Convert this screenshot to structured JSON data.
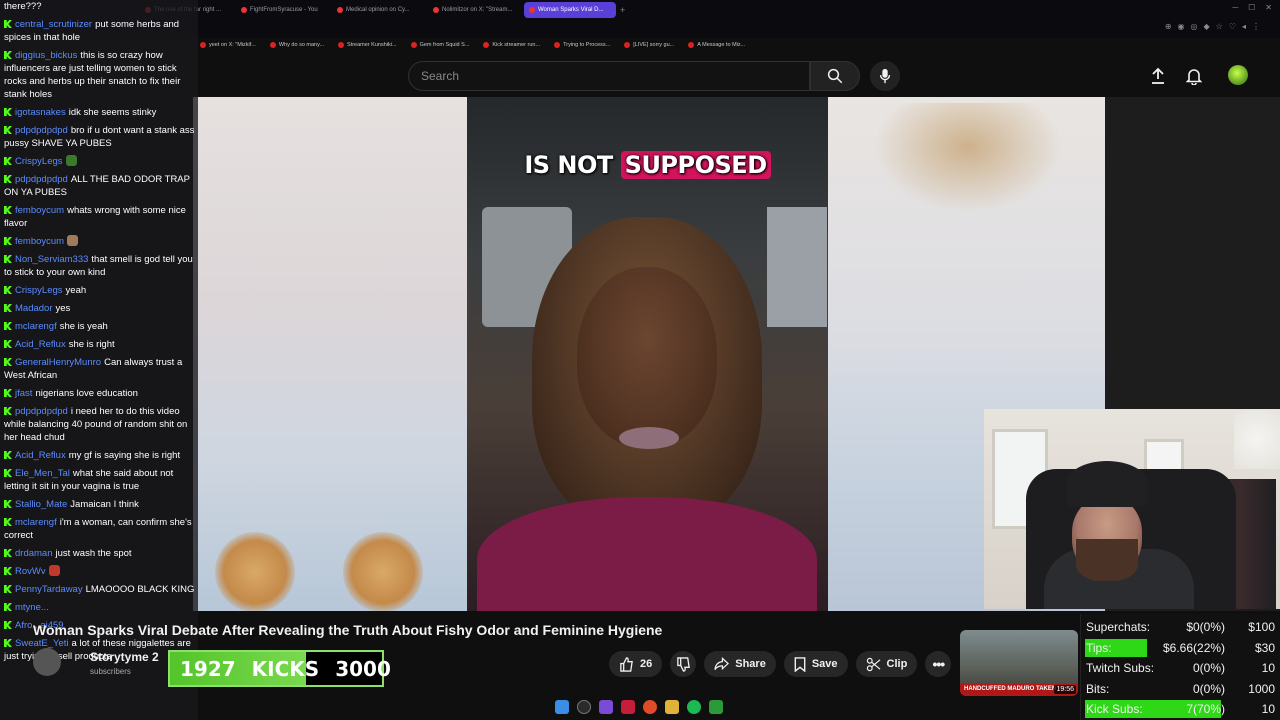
{
  "browser": {
    "tabs": [
      "The rise of the far right ...",
      "FightFromSyracuse - You",
      "Medical opinion on Cy...",
      "Nolimitzor on X: \"Stream...",
      "Woman Sparks Viral D..."
    ],
    "active_tab": 4,
    "bookmarks": [
      "yeet on X: \"Mizkif...",
      "Why do so many...",
      "Streamer Kunshiki...",
      "Gem from Squid S...",
      "Kick streamer run...",
      "Trying to Process...",
      "[LIVE] sorry gu...",
      "A Message to Miz..."
    ]
  },
  "header": {
    "search_placeholder": "Search"
  },
  "video": {
    "caption_plain": "IS NOT",
    "caption_highlight": "SUPPOSED",
    "title": "Woman Sparks Viral Debate After Revealing the Truth About Fishy Odor and Feminine Hygiene",
    "channel": "Storytyme 2",
    "channel_subs": "subscribers",
    "likes": "26",
    "share": "Share",
    "save": "Save",
    "clip": "Clip",
    "thumb_banner": "HANDCUFFED MADURO TAKEN TO",
    "thumb_duration": "19:56"
  },
  "kicks_goal": {
    "current": "1927",
    "label": "KICKS",
    "goal": "3000",
    "progress": 0.642
  },
  "stats": [
    {
      "label": "Superchats:",
      "value": "$0(0%)",
      "goal": "$100",
      "fill": 0.0,
      "highlight_label": false
    },
    {
      "label": "Tips:",
      "value": "$6.66(22%)",
      "goal": "$30",
      "fill": 0.22,
      "highlight_label": true
    },
    {
      "label": "Twitch Subs:",
      "value": "0(0%)",
      "goal": "10",
      "fill": 0.0,
      "highlight_label": false
    },
    {
      "label": "Bits:",
      "value": "0(0%)",
      "goal": "1000",
      "fill": 0.0,
      "highlight_label": false
    },
    {
      "label": "Kick Subs:",
      "value": "7(70%)",
      "goal": "10",
      "fill": 0.7,
      "highlight_label": true
    }
  ],
  "chat": {
    "first_line": "there???",
    "messages": [
      {
        "user": "central_scrutinizer",
        "text": "put some herbs and spices in that hole"
      },
      {
        "user": "diggius_bickus",
        "text": "this is so crazy how influencers are just telling women to stick rocks and herbs up their snatch to fix their stank holes"
      },
      {
        "user": "igotasnakes",
        "text": "idk she seems stinky"
      },
      {
        "user": "pdpdpdpdpd",
        "text": "bro if u dont want a stank ass pussy SHAVE YA PUBES"
      },
      {
        "user": "CrispyLegs",
        "text": "",
        "emote": "#3a7a2a"
      },
      {
        "user": "pdpdpdpdpd",
        "text": "ALL THE BAD ODOR TRAP ON YA PUBES"
      },
      {
        "user": "femboycum",
        "text": "whats wrong with some nice flavor"
      },
      {
        "user": "femboycum",
        "text": "",
        "emote": "#a07a5a"
      },
      {
        "user": "Non_Serviam333",
        "text": "that smell is god tell you to stick to your own kind"
      },
      {
        "user": "CrispyLegs",
        "text": "yeah"
      },
      {
        "user": "Madador",
        "text": "yes"
      },
      {
        "user": "mclarengf",
        "text": "she is yeah"
      },
      {
        "user": "Acid_Reflux",
        "text": "she is right"
      },
      {
        "user": "GeneralHenryMunro",
        "text": "Can always trust a West African"
      },
      {
        "user": "jfast",
        "text": "nigerians love education"
      },
      {
        "user": "pdpdpdpdpd",
        "text": "i need her to do this video while balancing 40 pound of random shit on her head chud"
      },
      {
        "user": "Acid_Reflux",
        "text": "my gf is saying she is right"
      },
      {
        "user": "Ele_Men_Tal",
        "text": "what she said about not letting it sit in your vagina is true"
      },
      {
        "user": "Stallio_Mate",
        "text": "Jamaican I think"
      },
      {
        "user": "mclarengf",
        "text": "i'm a woman, can confirm she's correct"
      },
      {
        "user": "drdaman",
        "text": "just wash the spot"
      },
      {
        "user": "RovWv",
        "text": "",
        "emote": "#c0392b"
      },
      {
        "user": "PennyTardaway",
        "text": "LMAOOOO BLACK KING"
      },
      {
        "user": "mtyne...",
        "text": ""
      },
      {
        "user": "Afro...ai459",
        "text": ""
      },
      {
        "user": "SweatE_Yeti",
        "text": "a lot of these niggalettes are just trying to sell products"
      }
    ]
  },
  "colors": {
    "kick_green": "#53fc18",
    "caption_highlight": "#d3135c",
    "username_blue": "#5b8cff",
    "active_tab": "#5b3fd9"
  }
}
